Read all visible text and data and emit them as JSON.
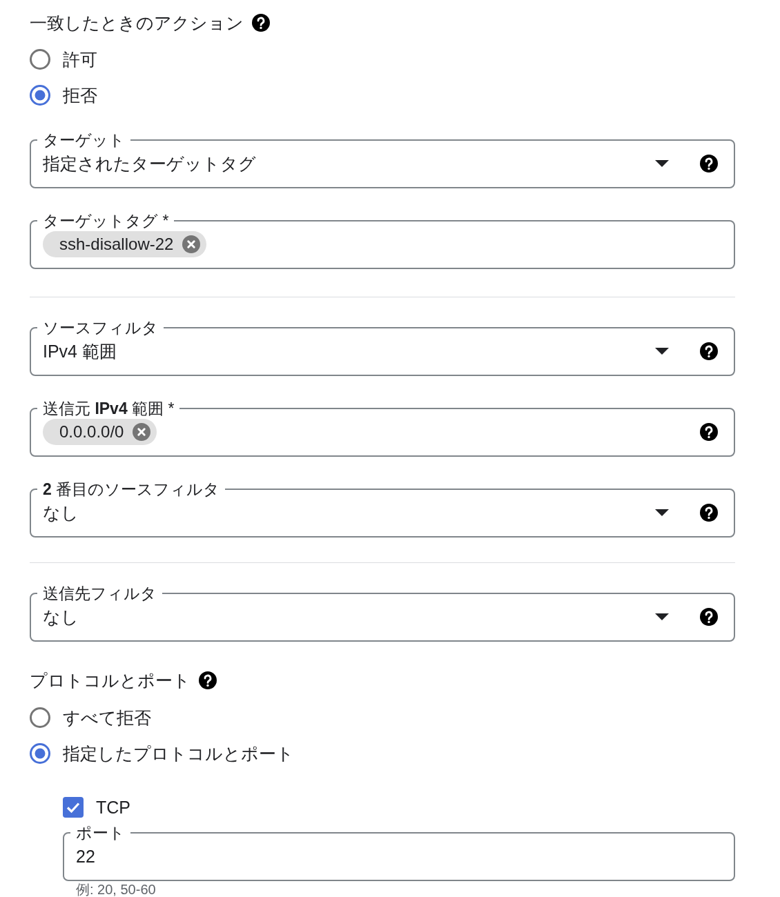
{
  "match_action": {
    "title": "一致したときのアクション",
    "help": true,
    "options": [
      {
        "label": "許可",
        "selected": false
      },
      {
        "label": "拒否",
        "selected": true
      }
    ]
  },
  "field_groups": [
    {
      "fields": [
        {
          "kind": "select",
          "label": "ターゲット",
          "value": "指定されたターゲットタグ",
          "help": true
        },
        {
          "kind": "chips",
          "label": "ターゲットタグ *",
          "chips": [
            "ssh-disallow-22"
          ],
          "help": false
        }
      ]
    },
    {
      "fields": [
        {
          "kind": "select",
          "label": "ソースフィルタ",
          "value": "IPv4 範囲",
          "help": true
        },
        {
          "kind": "chips",
          "label": "送信元 **IPv4** 範囲 *",
          "chips": [
            "0.0.0.0/0"
          ],
          "help": true
        },
        {
          "kind": "select",
          "label": "**2** 番目のソースフィルタ",
          "value": "なし",
          "help": true
        }
      ]
    },
    {
      "fields": [
        {
          "kind": "select",
          "label": "送信先フィルタ",
          "value": "なし",
          "help": true
        }
      ]
    }
  ],
  "protocols_and_ports": {
    "title": "プロトコルとポート",
    "help": true,
    "options": [
      {
        "label": "すべて拒否",
        "selected": false
      },
      {
        "label": "指定したプロトコルとポート",
        "selected": true
      }
    ],
    "protocols": [
      {
        "label": "TCP",
        "checked": true,
        "port_field": {
          "kind": "text",
          "label": "ポート",
          "value": "22",
          "hint": "例: 20, 50-60",
          "help": false
        }
      }
    ]
  }
}
